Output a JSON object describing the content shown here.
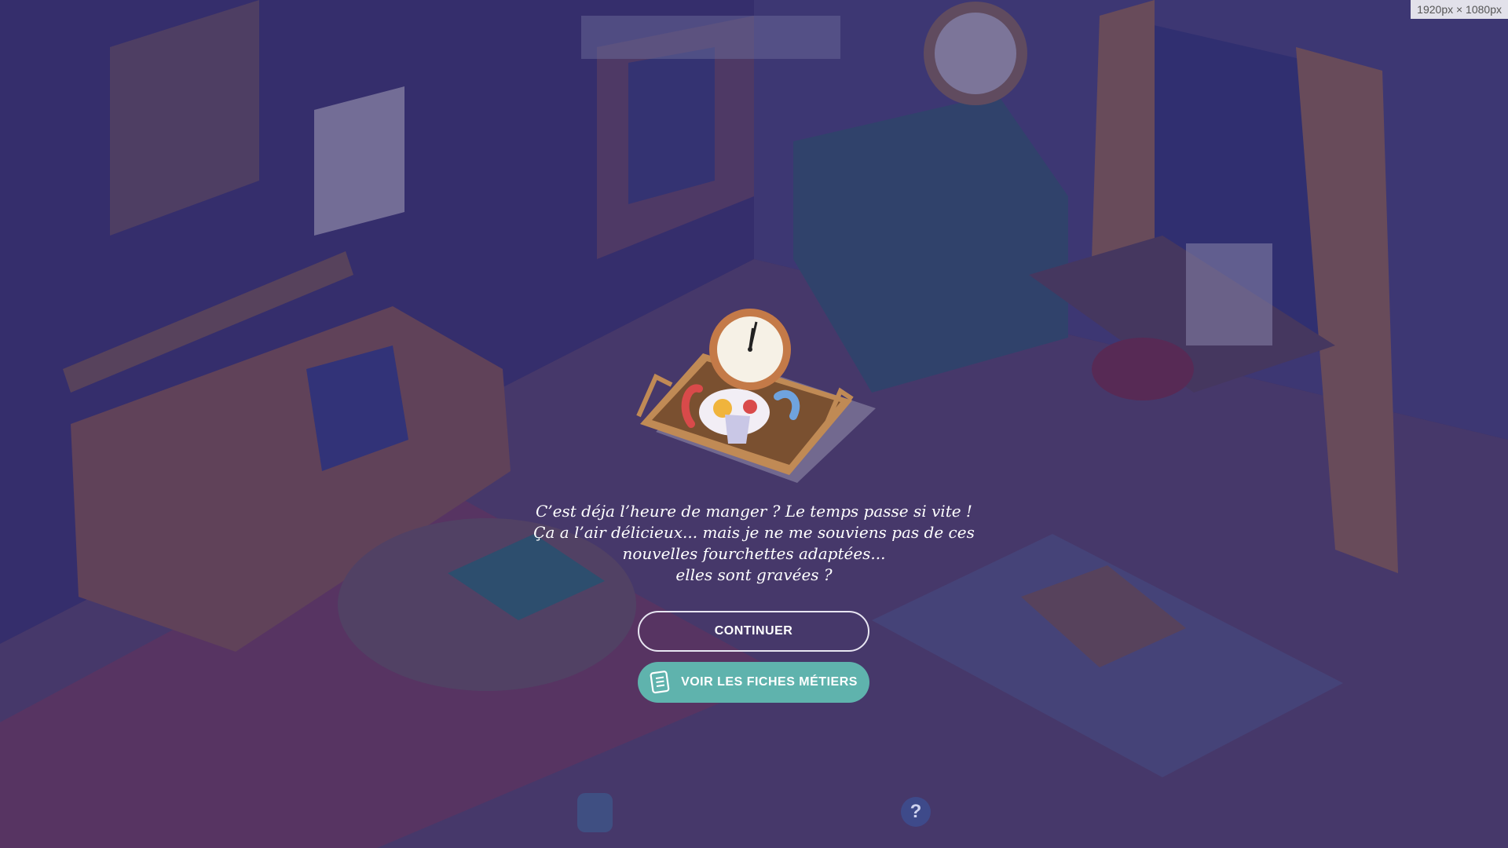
{
  "viewport_badge": "1920px × 1080px",
  "dialog": {
    "message_lines": [
      "C’est déja l’heure de manger ? Le temps passe si vite !",
      "Ça a l’air délicieux... mais je ne me souviens pas de ces",
      "nouvelles fourchettes adaptées...",
      "elles sont gravées ?"
    ],
    "continue_label": "CONTINUER",
    "fiches_label": "VOIR LES FICHES MÉTIERS"
  },
  "hud": {
    "help_glyph": "?"
  },
  "colors": {
    "overlay": "#2d265f",
    "accent_teal": "#5fb3ad",
    "wall": "#433a7a",
    "floor": "#5e4a72"
  },
  "icons": {
    "fiches": "document-list-icon",
    "help": "question-icon",
    "clock": "clock-icon"
  }
}
